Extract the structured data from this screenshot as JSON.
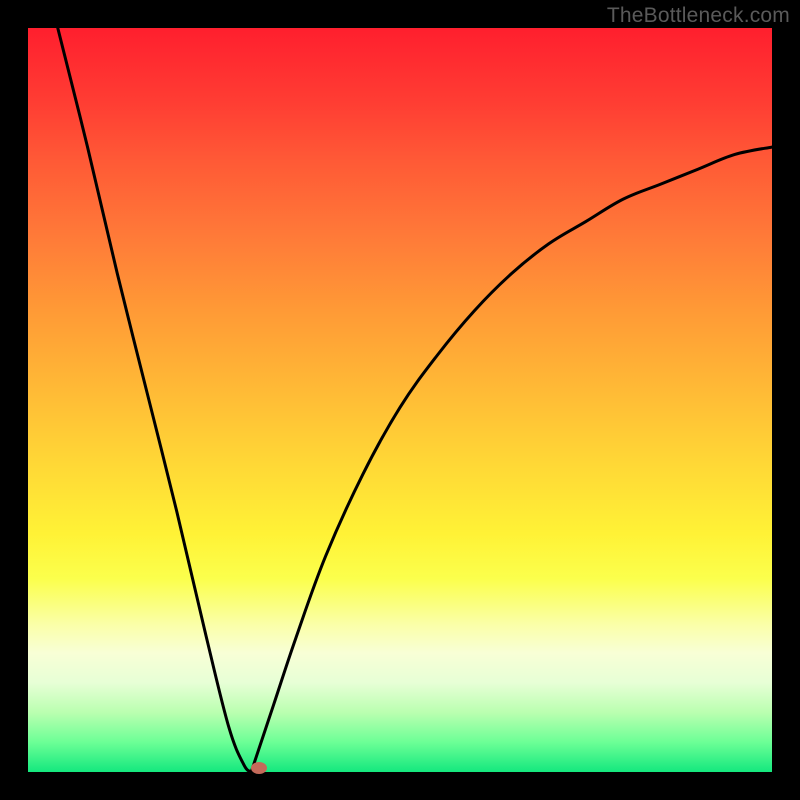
{
  "watermark": "TheBottleneck.com",
  "colors": {
    "curve_stroke": "#000000",
    "marker_fill": "#c46a5a"
  },
  "chart_data": {
    "type": "line",
    "title": "",
    "xlabel": "",
    "ylabel": "",
    "xlim": [
      0,
      100
    ],
    "ylim": [
      0,
      100
    ],
    "grid": false,
    "legend": false,
    "series": [
      {
        "name": "left-branch",
        "x": [
          4,
          8,
          12,
          16,
          20,
          24,
          27,
          29,
          30
        ],
        "values": [
          100,
          84,
          67,
          51,
          35,
          18,
          6,
          1,
          0
        ]
      },
      {
        "name": "right-branch",
        "x": [
          30,
          33,
          36,
          40,
          45,
          50,
          55,
          60,
          65,
          70,
          75,
          80,
          85,
          90,
          95,
          100
        ],
        "values": [
          0,
          9,
          18,
          29,
          40,
          49,
          56,
          62,
          67,
          71,
          74,
          77,
          79,
          81,
          83,
          84
        ]
      }
    ],
    "annotations": [
      {
        "name": "minimum-marker",
        "x": 31,
        "y": 0.5
      }
    ]
  }
}
